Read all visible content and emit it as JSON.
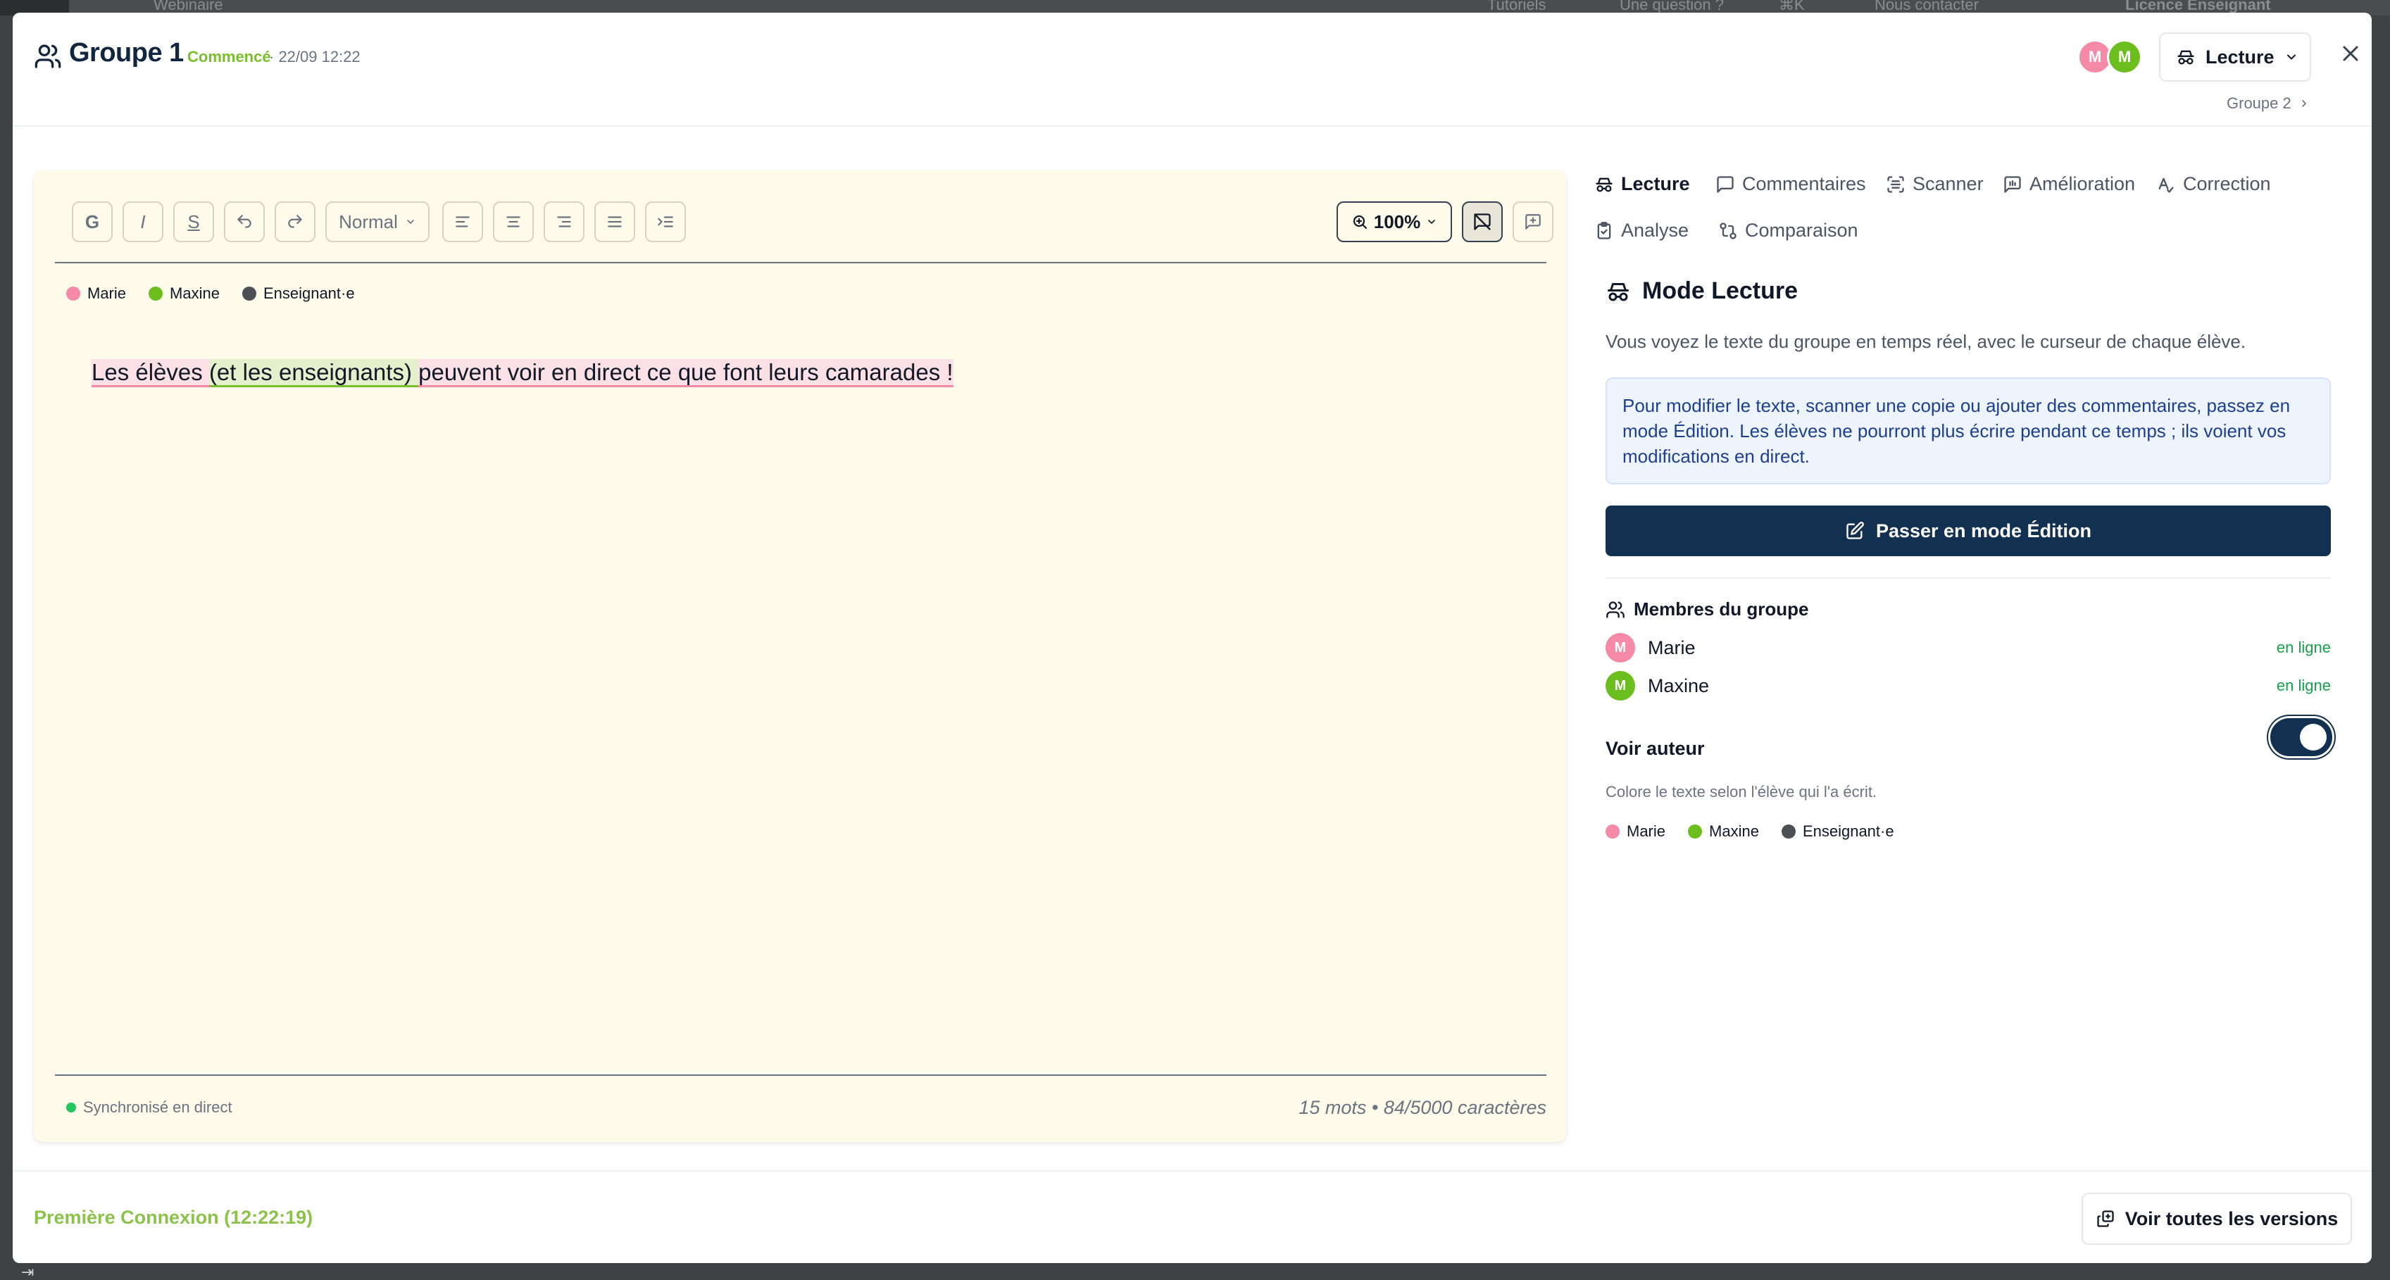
{
  "background": {
    "topbar_items": [
      "Webinaire",
      "Tutoriels",
      "Une question ?",
      "⌘K",
      "Nous contacter",
      "Licence Enseignant"
    ]
  },
  "header": {
    "title": "Groupe 1",
    "status": "Commencé",
    "date": "· 22/09 12:22",
    "avatars": [
      {
        "initial": "M",
        "color": "#f48aa8"
      },
      {
        "initial": "M",
        "color": "#6cbd1e"
      }
    ],
    "mode_label": "Lecture",
    "next_group": "Groupe 2"
  },
  "editor": {
    "toolbar": {
      "bold": "G",
      "italic": "I",
      "strike": "S",
      "style_select": "Normal",
      "zoom": "100%"
    },
    "legend": [
      {
        "name": "Marie",
        "color": "#f48aa8"
      },
      {
        "name": "Maxine",
        "color": "#6cbd1e"
      },
      {
        "name": "Enseignant·e",
        "color": "#4b5055"
      }
    ],
    "content": {
      "part1": "Les élèves ",
      "part2": "(et les enseignants) ",
      "part3": "peuvent voir en direct ce que font leurs camarades !"
    },
    "sync_status": "Synchronisé en direct",
    "count": "15 mots • 84/5000 caractères"
  },
  "tabs": [
    {
      "label": "Lecture",
      "icon": "spy-icon"
    },
    {
      "label": "Commentaires",
      "icon": "comment-icon"
    },
    {
      "label": "Scanner",
      "icon": "scan-icon"
    },
    {
      "label": "Amélioration",
      "icon": "improve-icon"
    },
    {
      "label": "Correction",
      "icon": "correction-icon"
    },
    {
      "label": "Analyse",
      "icon": "clipboard-icon"
    },
    {
      "label": "Comparaison",
      "icon": "compare-icon"
    }
  ],
  "panel": {
    "title": "Mode Lecture",
    "description": "Vous voyez le texte du groupe en temps réel, avec le curseur de chaque élève.",
    "info": "Pour modifier le texte, scanner une copie ou ajouter des commentaires, passez en mode Édition. Les élèves ne pourront plus écrire pendant ce temps ; ils voient vos modifications en direct.",
    "edit_button": "Passer en mode Édition",
    "members_title": "Membres du groupe",
    "members": [
      {
        "initial": "M",
        "name": "Marie",
        "status": "en ligne",
        "color": "#f48aa8"
      },
      {
        "initial": "M",
        "name": "Maxine",
        "status": "en ligne",
        "color": "#6cbd1e"
      }
    ],
    "voir_auteur": "Voir auteur",
    "voir_auteur_on": true,
    "voir_auteur_desc": "Colore le texte selon l'élève qui l'a écrit.",
    "legend": [
      {
        "name": "Marie",
        "color": "#f48aa8"
      },
      {
        "name": "Maxine",
        "color": "#6cbd1e"
      },
      {
        "name": "Enseignant·e",
        "color": "#4b5055"
      }
    ]
  },
  "footer": {
    "first_connection": "Première Connexion (12:22:19)",
    "versions_button": "Voir toutes les versions"
  }
}
